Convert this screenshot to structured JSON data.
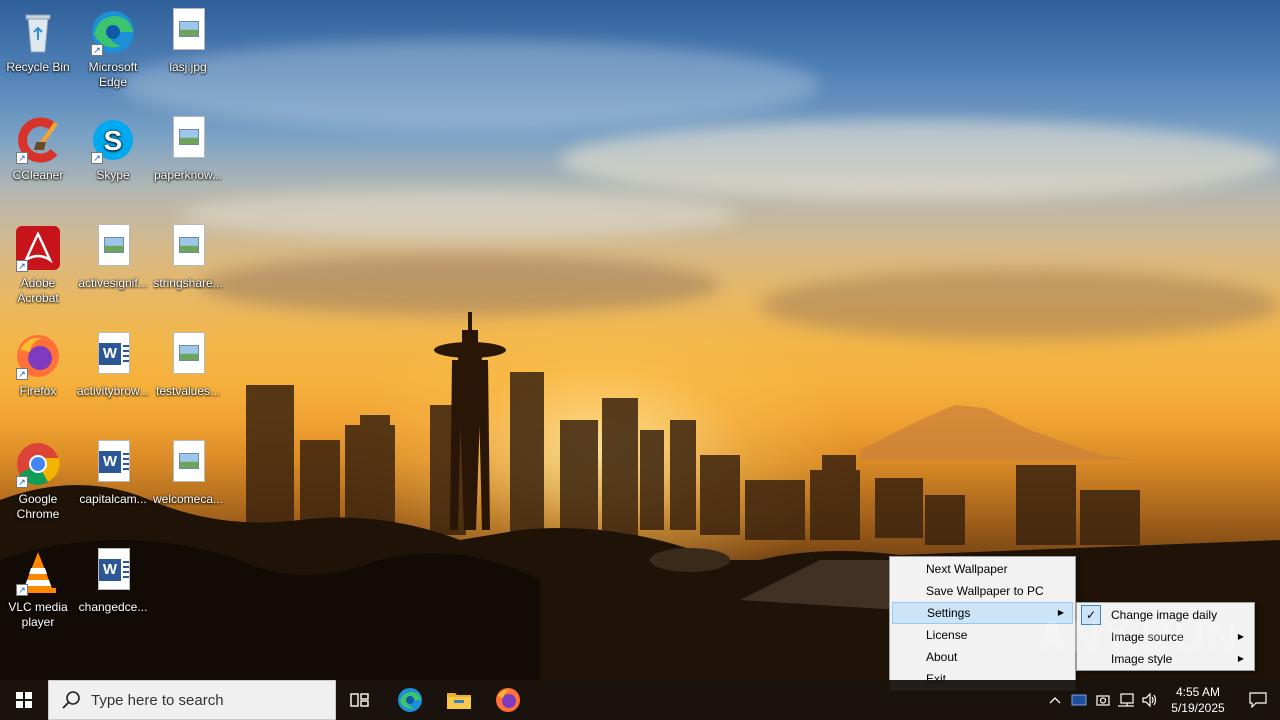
{
  "desktop": {
    "icons": [
      {
        "label": "Recycle Bin",
        "icon": "recycle-bin-icon"
      },
      {
        "label": "Microsoft Edge",
        "icon": "edge-icon"
      },
      {
        "label": "lasj.jpg",
        "icon": "image-file-icon"
      },
      {
        "label": "CCleaner",
        "icon": "ccleaner-icon"
      },
      {
        "label": "Skype",
        "icon": "skype-icon"
      },
      {
        "label": "paperknow...",
        "icon": "image-file-icon"
      },
      {
        "label": "Adobe Acrobat",
        "icon": "acrobat-icon"
      },
      {
        "label": "activesignif...",
        "icon": "image-file-icon"
      },
      {
        "label": "stringshare...",
        "icon": "image-file-icon"
      },
      {
        "label": "Firefox",
        "icon": "firefox-icon"
      },
      {
        "label": "activitybrow...",
        "icon": "word-doc-icon"
      },
      {
        "label": "testvalues...",
        "icon": "image-file-icon"
      },
      {
        "label": "Google Chrome",
        "icon": "chrome-icon"
      },
      {
        "label": "capitalcam...",
        "icon": "word-doc-icon"
      },
      {
        "label": "welcomeca...",
        "icon": "image-file-icon"
      },
      {
        "label": "VLC media player",
        "icon": "vlc-icon"
      },
      {
        "label": "changedce...",
        "icon": "word-doc-icon"
      }
    ]
  },
  "context_menu": {
    "items": [
      {
        "label": "Next Wallpaper"
      },
      {
        "label": "Save Wallpaper to PC"
      },
      {
        "label": "Settings",
        "highlighted": true,
        "has_submenu": true
      },
      {
        "label": "License"
      },
      {
        "label": "About"
      },
      {
        "label": "Exit"
      }
    ],
    "submenu": {
      "items": [
        {
          "label": "Change image daily",
          "checked": true
        },
        {
          "label": "Image source",
          "has_submenu": true
        },
        {
          "label": "Image style",
          "has_submenu": true
        }
      ]
    }
  },
  "taskbar": {
    "search_placeholder": "Type here to search",
    "pinned": [
      "task-view-icon",
      "edge-icon",
      "file-explorer-icon",
      "firefox-icon"
    ],
    "tray": [
      "chevron-up-icon",
      "app-tray-icon",
      "camera-icon",
      "network-icon",
      "volume-icon"
    ],
    "time": "4:55 AM",
    "date": "5/19/2025"
  },
  "watermark": "ANY.RUN",
  "colors": {
    "taskbar": "#18120e",
    "menu_bg": "#f2f2f2",
    "menu_highlight": "#cce4f7",
    "accent": "#0078d7"
  }
}
